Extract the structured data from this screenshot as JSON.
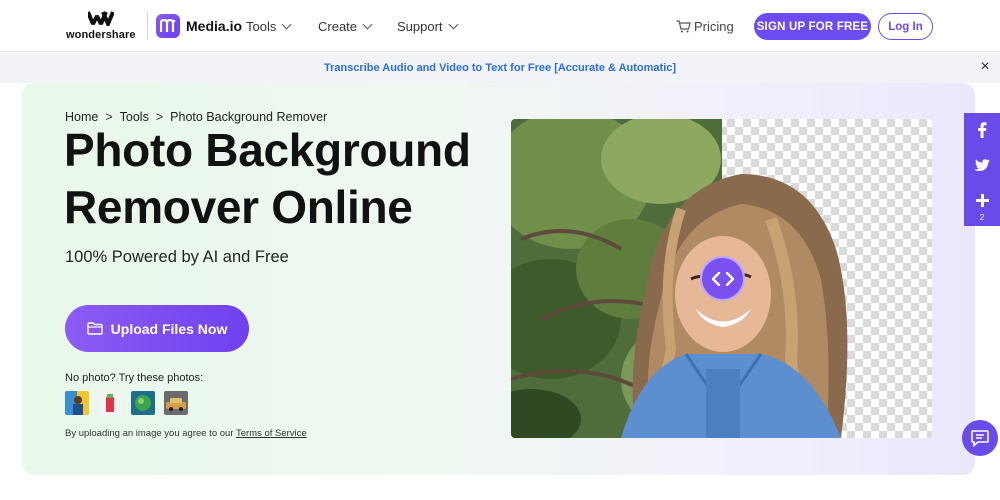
{
  "nav": {
    "brand": "wondershare",
    "product": "Media.io",
    "menu": [
      {
        "label": "Tools"
      },
      {
        "label": "Create"
      },
      {
        "label": "Support"
      }
    ],
    "pricing": "Pricing",
    "signup": "SIGN UP FOR FREE",
    "login": "Log In"
  },
  "banner": {
    "text": "Transcribe Audio and Video to Text for Free [Accurate & Automatic]"
  },
  "breadcrumb": {
    "items": [
      "Home",
      "Tools",
      "Photo Background Remover"
    ],
    "separator": ">"
  },
  "hero": {
    "title_line1": "Photo Background",
    "title_line2": "Remover Online",
    "subtitle": "100% Powered by AI and Free",
    "upload_label": "Upload Files Now",
    "try_label": "No photo? Try these photos:",
    "terms_prefix": "By uploading an image you agree to our",
    "terms_link": "Terms of Service"
  },
  "share": {
    "count": "2"
  },
  "colors": {
    "accent": "#6c4cf0",
    "banner_link": "#2b6fe0"
  },
  "icons": [
    "wondershare-logo-icon",
    "media-io-icon",
    "cart-icon",
    "folder-icon",
    "facebook-icon",
    "twitter-icon",
    "plus-icon",
    "chat-icon",
    "close-icon",
    "compare-arrows-icon"
  ]
}
